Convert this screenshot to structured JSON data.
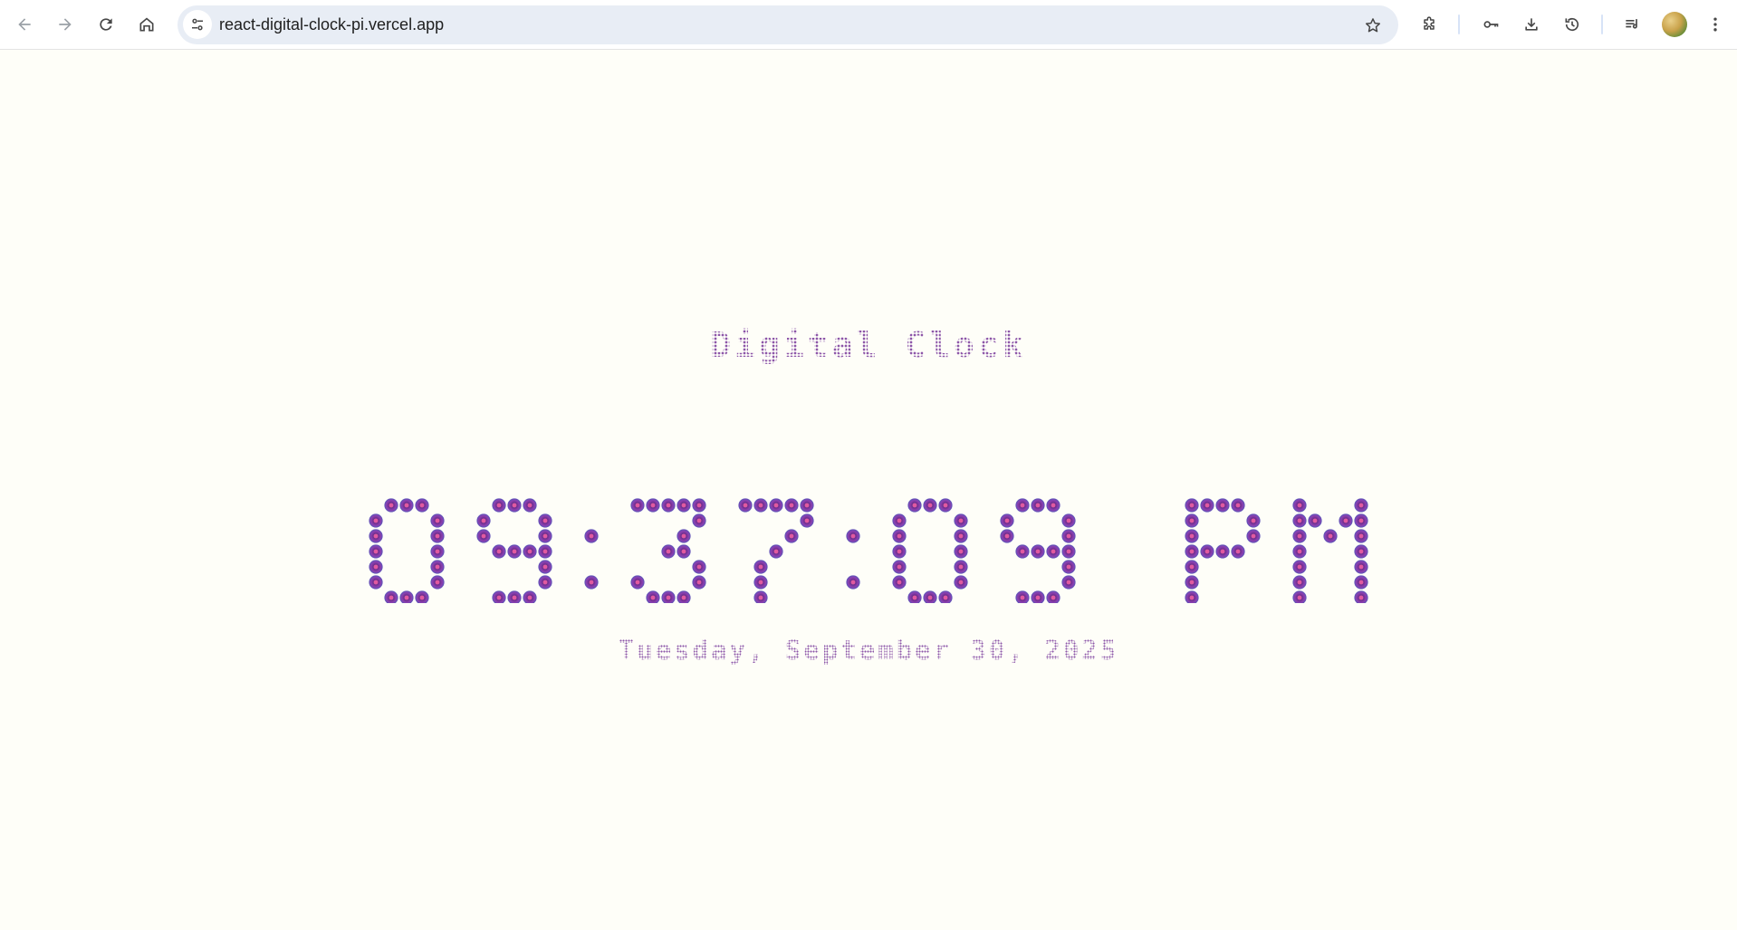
{
  "browser": {
    "url": "react-digital-clock-pi.vercel.app",
    "icons": {
      "back": "back-arrow-icon",
      "forward": "forward-arrow-icon",
      "reload": "reload-icon",
      "home": "home-icon",
      "site_info": "tune-icon",
      "bookmark": "star-icon",
      "extensions": "puzzle-icon",
      "passwords": "key-icon",
      "downloads": "download-icon",
      "history": "history-icon",
      "media": "media-queue-icon",
      "profile": "avatar",
      "menu": "kebab-menu-icon"
    }
  },
  "clock": {
    "title": "Digital Clock",
    "time": "09:37:09 PM",
    "date": "Tuesday, September 30, 2025",
    "colors": {
      "dot_fill": "#8d3fb0",
      "dot_ring": "#5a55b8",
      "dot_center": "#e05aa0",
      "text": "#8d56a8",
      "background": "#fefef8"
    }
  }
}
